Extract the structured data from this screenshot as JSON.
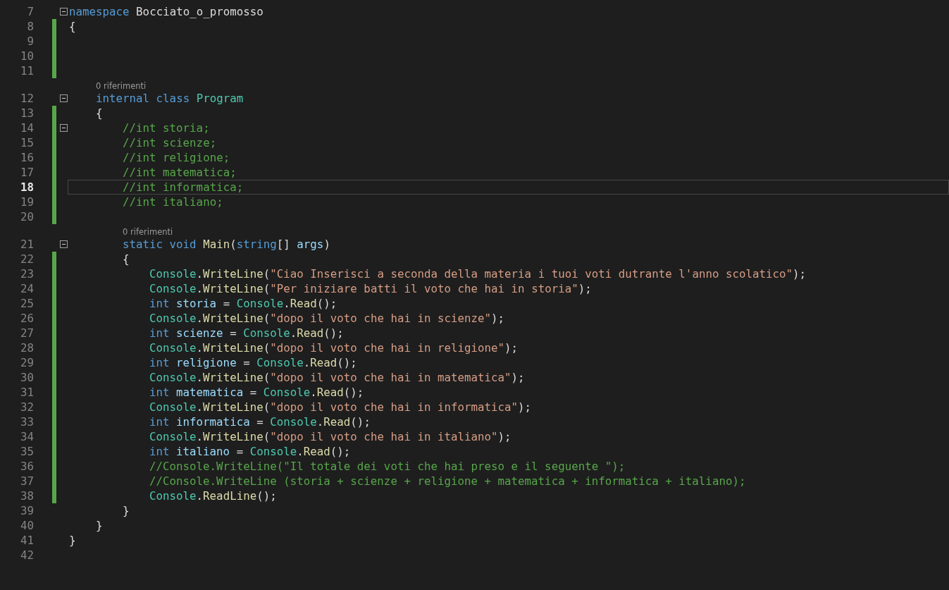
{
  "lines": [
    {
      "number": "7",
      "modified": false,
      "current": false,
      "expanded": true,
      "tokens": [
        {
          "kind": "keyword",
          "text": "namespace "
        },
        {
          "kind": "plain",
          "text": "Bocciato_o_promosso"
        }
      ]
    },
    {
      "number": "8",
      "modified": true,
      "current": false,
      "tokens": [
        {
          "kind": "plain",
          "text": "{"
        }
      ],
      "children": [
        {
          "number": "9",
          "modified": true,
          "current": false
        },
        {
          "number": "10",
          "modified": true,
          "current": false
        },
        {
          "number": "11",
          "modified": true,
          "current": false
        },
        {
          "number": "12",
          "modified": false,
          "current": false,
          "expanded": true,
          "codelens": "0 riferimenti",
          "tokens": [
            {
              "kind": "keyword",
              "text": "internal class "
            },
            {
              "kind": "type",
              "text": "Program"
            }
          ]
        },
        {
          "number": "13",
          "modified": true,
          "current": false,
          "tokens": [
            {
              "kind": "plain",
              "text": "{"
            }
          ],
          "children": [
            {
              "number": "14",
              "modified": true,
              "current": false,
              "expanded": true,
              "tokens": [
                {
                  "kind": "comment",
                  "text": "//int storia;"
                }
              ]
            },
            {
              "number": "15",
              "modified": true,
              "current": false,
              "tokens": [
                {
                  "kind": "comment",
                  "text": "//int scienze;"
                }
              ]
            },
            {
              "number": "16",
              "modified": true,
              "current": false,
              "tokens": [
                {
                  "kind": "comment",
                  "text": "//int religione;"
                }
              ]
            },
            {
              "number": "17",
              "modified": true,
              "current": false,
              "tokens": [
                {
                  "kind": "comment",
                  "text": "//int matematica;"
                }
              ]
            },
            {
              "number": "18",
              "modified": true,
              "current": true,
              "tokens": [
                {
                  "kind": "comment",
                  "text": "//int informatica;"
                }
              ]
            },
            {
              "number": "19",
              "modified": true,
              "current": false,
              "tokens": [
                {
                  "kind": "comment",
                  "text": "//int italiano;"
                }
              ]
            },
            {
              "number": "20",
              "modified": true,
              "current": false
            },
            {
              "number": "21",
              "modified": false,
              "current": false,
              "expanded": true,
              "codelens": "0 riferimenti",
              "tokens": [
                {
                  "kind": "keyword",
                  "text": "static void "
                },
                {
                  "kind": "method",
                  "text": "Main"
                },
                {
                  "kind": "plain",
                  "text": "("
                },
                {
                  "kind": "keyword",
                  "text": "string"
                },
                {
                  "kind": "plain",
                  "text": "[] "
                },
                {
                  "kind": "variable",
                  "text": "args"
                },
                {
                  "kind": "plain",
                  "text": ")"
                }
              ]
            },
            {
              "number": "22",
              "modified": true,
              "current": false,
              "tokens": [
                {
                  "kind": "plain",
                  "text": "{"
                }
              ],
              "children": [
                {
                  "number": "23",
                  "modified": true,
                  "current": false,
                  "tokens": [
                    {
                      "kind": "type",
                      "text": "Console"
                    },
                    {
                      "kind": "plain",
                      "text": "."
                    },
                    {
                      "kind": "method",
                      "text": "WriteLine"
                    },
                    {
                      "kind": "plain",
                      "text": "("
                    },
                    {
                      "kind": "string",
                      "text": "\"Ciao Inserisci a seconda della materia i tuoi voti dutrante l'anno scolatico\""
                    },
                    {
                      "kind": "plain",
                      "text": ");"
                    }
                  ]
                },
                {
                  "number": "24",
                  "modified": true,
                  "current": false,
                  "tokens": [
                    {
                      "kind": "type",
                      "text": "Console"
                    },
                    {
                      "kind": "plain",
                      "text": "."
                    },
                    {
                      "kind": "method",
                      "text": "WriteLine"
                    },
                    {
                      "kind": "plain",
                      "text": "("
                    },
                    {
                      "kind": "string",
                      "text": "\"Per iniziare batti il voto che hai in storia\""
                    },
                    {
                      "kind": "plain",
                      "text": ");"
                    }
                  ]
                },
                {
                  "number": "25",
                  "modified": true,
                  "current": false,
                  "tokens": [
                    {
                      "kind": "keyword",
                      "text": "int "
                    },
                    {
                      "kind": "variable",
                      "text": "storia"
                    },
                    {
                      "kind": "plain",
                      "text": " = "
                    },
                    {
                      "kind": "type",
                      "text": "Console"
                    },
                    {
                      "kind": "plain",
                      "text": "."
                    },
                    {
                      "kind": "method",
                      "text": "Read"
                    },
                    {
                      "kind": "plain",
                      "text": "();"
                    }
                  ]
                },
                {
                  "number": "26",
                  "modified": true,
                  "current": false,
                  "tokens": [
                    {
                      "kind": "type",
                      "text": "Console"
                    },
                    {
                      "kind": "plain",
                      "text": "."
                    },
                    {
                      "kind": "method",
                      "text": "WriteLine"
                    },
                    {
                      "kind": "plain",
                      "text": "("
                    },
                    {
                      "kind": "string",
                      "text": "\"dopo il voto che hai in scienze\""
                    },
                    {
                      "kind": "plain",
                      "text": ");"
                    }
                  ]
                },
                {
                  "number": "27",
                  "modified": true,
                  "current": false,
                  "tokens": [
                    {
                      "kind": "keyword",
                      "text": "int "
                    },
                    {
                      "kind": "variable",
                      "text": "scienze"
                    },
                    {
                      "kind": "plain",
                      "text": " = "
                    },
                    {
                      "kind": "type",
                      "text": "Console"
                    },
                    {
                      "kind": "plain",
                      "text": "."
                    },
                    {
                      "kind": "method",
                      "text": "Read"
                    },
                    {
                      "kind": "plain",
                      "text": "();"
                    }
                  ]
                },
                {
                  "number": "28",
                  "modified": true,
                  "current": false,
                  "tokens": [
                    {
                      "kind": "type",
                      "text": "Console"
                    },
                    {
                      "kind": "plain",
                      "text": "."
                    },
                    {
                      "kind": "method",
                      "text": "WriteLine"
                    },
                    {
                      "kind": "plain",
                      "text": "("
                    },
                    {
                      "kind": "string",
                      "text": "\"dopo il voto che hai in religione\""
                    },
                    {
                      "kind": "plain",
                      "text": ");"
                    }
                  ]
                },
                {
                  "number": "29",
                  "modified": true,
                  "current": false,
                  "tokens": [
                    {
                      "kind": "keyword",
                      "text": "int "
                    },
                    {
                      "kind": "variable",
                      "text": "religione"
                    },
                    {
                      "kind": "plain",
                      "text": " = "
                    },
                    {
                      "kind": "type",
                      "text": "Console"
                    },
                    {
                      "kind": "plain",
                      "text": "."
                    },
                    {
                      "kind": "method",
                      "text": "Read"
                    },
                    {
                      "kind": "plain",
                      "text": "();"
                    }
                  ]
                },
                {
                  "number": "30",
                  "modified": true,
                  "current": false,
                  "tokens": [
                    {
                      "kind": "type",
                      "text": "Console"
                    },
                    {
                      "kind": "plain",
                      "text": "."
                    },
                    {
                      "kind": "method",
                      "text": "WriteLine"
                    },
                    {
                      "kind": "plain",
                      "text": "("
                    },
                    {
                      "kind": "string",
                      "text": "\"dopo il voto che hai in matematica\""
                    },
                    {
                      "kind": "plain",
                      "text": ");"
                    }
                  ]
                },
                {
                  "number": "31",
                  "modified": true,
                  "current": false,
                  "tokens": [
                    {
                      "kind": "keyword",
                      "text": "int "
                    },
                    {
                      "kind": "variable",
                      "text": "matematica"
                    },
                    {
                      "kind": "plain",
                      "text": " = "
                    },
                    {
                      "kind": "type",
                      "text": "Console"
                    },
                    {
                      "kind": "plain",
                      "text": "."
                    },
                    {
                      "kind": "method",
                      "text": "Read"
                    },
                    {
                      "kind": "plain",
                      "text": "();"
                    }
                  ]
                },
                {
                  "number": "32",
                  "modified": true,
                  "current": false,
                  "tokens": [
                    {
                      "kind": "type",
                      "text": "Console"
                    },
                    {
                      "kind": "plain",
                      "text": "."
                    },
                    {
                      "kind": "method",
                      "text": "WriteLine"
                    },
                    {
                      "kind": "plain",
                      "text": "("
                    },
                    {
                      "kind": "string",
                      "text": "\"dopo il voto che hai in informatica\""
                    },
                    {
                      "kind": "plain",
                      "text": ");"
                    }
                  ]
                },
                {
                  "number": "33",
                  "modified": true,
                  "current": false,
                  "tokens": [
                    {
                      "kind": "keyword",
                      "text": "int "
                    },
                    {
                      "kind": "variable",
                      "text": "informatica"
                    },
                    {
                      "kind": "plain",
                      "text": " = "
                    },
                    {
                      "kind": "type",
                      "text": "Console"
                    },
                    {
                      "kind": "plain",
                      "text": "."
                    },
                    {
                      "kind": "method",
                      "text": "Read"
                    },
                    {
                      "kind": "plain",
                      "text": "();"
                    }
                  ]
                },
                {
                  "number": "34",
                  "modified": true,
                  "current": false,
                  "tokens": [
                    {
                      "kind": "type",
                      "text": "Console"
                    },
                    {
                      "kind": "plain",
                      "text": "."
                    },
                    {
                      "kind": "method",
                      "text": "WriteLine"
                    },
                    {
                      "kind": "plain",
                      "text": "("
                    },
                    {
                      "kind": "string",
                      "text": "\"dopo il voto che hai in italiano\""
                    },
                    {
                      "kind": "plain",
                      "text": ");"
                    }
                  ]
                },
                {
                  "number": "35",
                  "modified": true,
                  "current": false,
                  "tokens": [
                    {
                      "kind": "keyword",
                      "text": "int "
                    },
                    {
                      "kind": "variable",
                      "text": "italiano"
                    },
                    {
                      "kind": "plain",
                      "text": " = "
                    },
                    {
                      "kind": "type",
                      "text": "Console"
                    },
                    {
                      "kind": "plain",
                      "text": "."
                    },
                    {
                      "kind": "method",
                      "text": "Read"
                    },
                    {
                      "kind": "plain",
                      "text": "();"
                    }
                  ]
                },
                {
                  "number": "36",
                  "modified": true,
                  "current": false,
                  "tokens": [
                    {
                      "kind": "comment",
                      "text": "//Console.WriteLine(\"Il totale dei voti che hai preso e il seguente \");"
                    }
                  ]
                },
                {
                  "number": "37",
                  "modified": true,
                  "current": false,
                  "tokens": [
                    {
                      "kind": "comment",
                      "text": "//Console.WriteLine (storia + scienze + religione + matematica + informatica + italiano);"
                    }
                  ]
                },
                {
                  "number": "38",
                  "modified": true,
                  "current": false,
                  "tokens": [
                    {
                      "kind": "type",
                      "text": "Console"
                    },
                    {
                      "kind": "plain",
                      "text": "."
                    },
                    {
                      "kind": "method",
                      "text": "ReadLine"
                    },
                    {
                      "kind": "plain",
                      "text": "();"
                    }
                  ]
                }
              ]
            },
            {
              "number": "39",
              "modified": false,
              "current": false,
              "tokens": [
                {
                  "kind": "plain",
                  "text": "}"
                }
              ]
            }
          ]
        },
        {
          "number": "40",
          "modified": false,
          "current": false,
          "tokens": [
            {
              "kind": "plain",
              "text": "}"
            }
          ]
        }
      ]
    },
    {
      "number": "41",
      "modified": false,
      "current": false,
      "tokens": [
        {
          "kind": "plain",
          "text": "}"
        }
      ]
    },
    {
      "number": "42",
      "modified": false,
      "current": false
    }
  ]
}
